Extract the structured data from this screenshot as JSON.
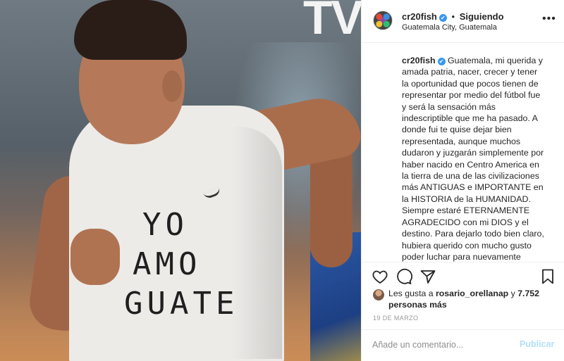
{
  "photo": {
    "logo_text": "TV",
    "shirt_lines": [
      "YO",
      "AMO",
      "GUATE"
    ]
  },
  "header": {
    "username": "cr20fish",
    "verified_icon": "✔",
    "separator": "•",
    "follow_status": "Siguiendo",
    "location": "Guatemala City, Guatemala",
    "more_icon": "•••"
  },
  "caption": {
    "username": "cr20fish",
    "text": "Guatemala, mi querida y amada patria, nacer, crecer y tener la oportunidad que pocos tienen de representar por medio del fútbol fue y será la sensación más indescriptible que me ha pasado. A donde fui te quise dejar bien representada, aunque muchos dudaron y juzgarán simplemente por haber nacido en Centro America en la tierra de una de las civilizaciones más ANTIGUAS e IMPORTANTE en la HISTORIA de la HUMANIDAD. Siempre estaré ETERNAMENTE AGRADECIDO con mi DIOS y el destino. Para dejarlo todo bien claro, hubiera querido con mucho gusto poder luchar para nuevamente representar tus colores desde la Federación del"
  },
  "likes": {
    "prefix": "Les gusta a ",
    "user": "rosario_orellanap",
    "middle": " y",
    "count": "7.752 personas más"
  },
  "date": "19 DE MARZO",
  "comment": {
    "placeholder": "Añade un comentario...",
    "publish_label": "Publicar"
  }
}
